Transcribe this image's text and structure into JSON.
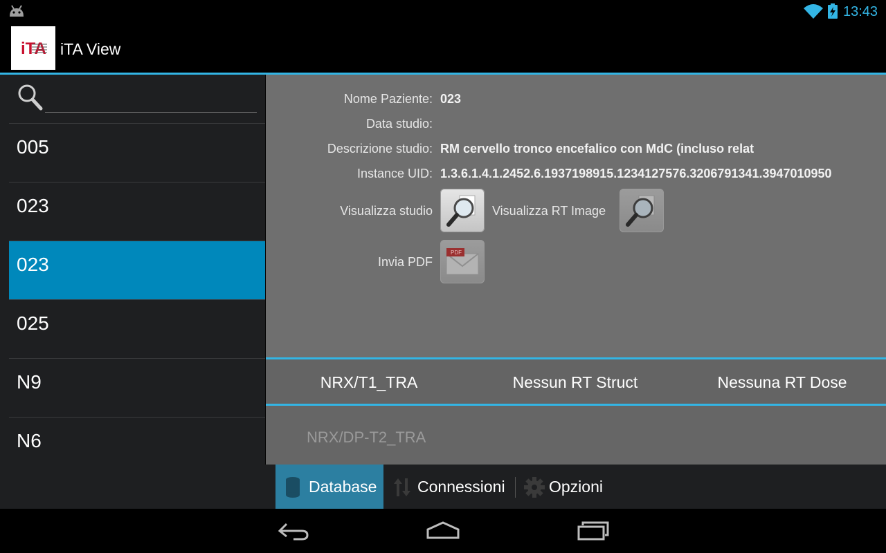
{
  "status": {
    "time": "13:43"
  },
  "app": {
    "title": "iTA View",
    "logo_text": "iTA"
  },
  "search": {
    "value": ""
  },
  "patients": [
    "005",
    "023",
    "023",
    "025",
    "N9",
    "N6"
  ],
  "selected_index": 2,
  "details": {
    "nome_label": "Nome Paziente:",
    "nome_value": "023",
    "data_label": "Data studio:",
    "data_value": "",
    "descrizione_label": "Descrizione studio:",
    "descrizione_value": "RM cervello tronco encefalico con MdC (incluso relat",
    "uid_label": "Instance UID:",
    "uid_value": "1.3.6.1.4.1.2452.6.1937198915.1234127576.3206791341.3947010950",
    "visualizza_studio_label": "Visualizza studio",
    "visualizza_rt_label": "Visualizza RT Image",
    "invia_pdf_label": "Invia PDF",
    "pdf_icon_text": "PDF"
  },
  "series_tabs": [
    "NRX/T1_TRA",
    "Nessun RT Struct",
    "Nessuna RT Dose"
  ],
  "series_items": [
    "NRX/DP-T2_TRA"
  ],
  "bottom_tabs": {
    "database": "Database",
    "connessioni": "Connessioni",
    "opzioni": "Opzioni"
  },
  "colors": {
    "accent": "#33b5e5",
    "selected": "#0088bb",
    "active_tab": "#2c7fa1"
  }
}
